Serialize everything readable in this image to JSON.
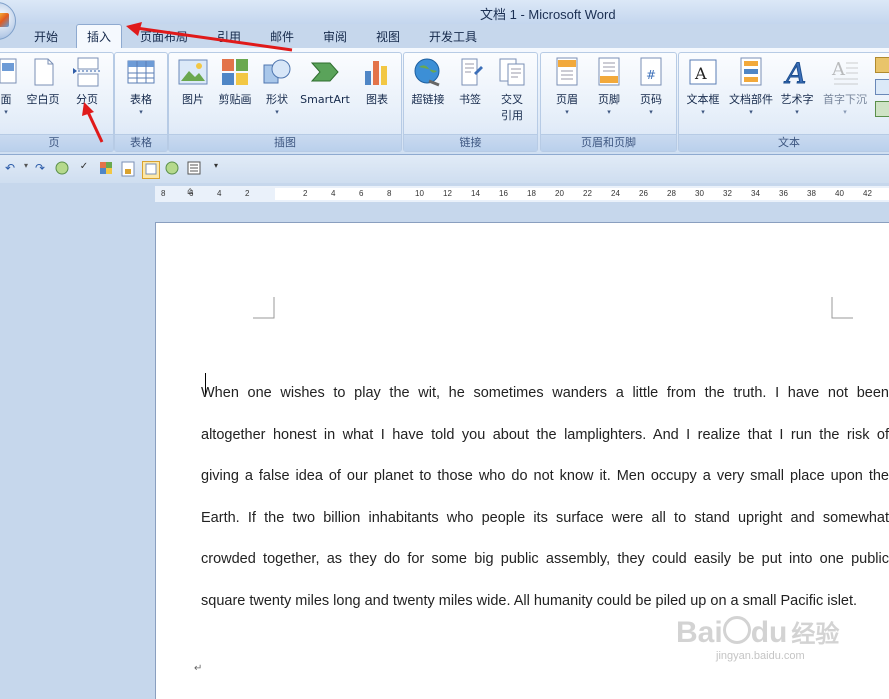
{
  "window": {
    "title": "文档 1 - Microsoft Word"
  },
  "tabs": [
    {
      "label": "开始"
    },
    {
      "label": "插入"
    },
    {
      "label": "页面布局"
    },
    {
      "label": "引用"
    },
    {
      "label": "邮件"
    },
    {
      "label": "审阅"
    },
    {
      "label": "视图"
    },
    {
      "label": "开发工具"
    }
  ],
  "groups": {
    "page": {
      "label": "页",
      "buttons": [
        "面",
        "空白页",
        "分页"
      ]
    },
    "table": {
      "label": "表格",
      "buttons": [
        "表格"
      ]
    },
    "illustrations": {
      "label": "插图",
      "buttons": [
        "图片",
        "剪贴画",
        "形状",
        "SmartArt",
        "图表"
      ]
    },
    "links": {
      "label": "链接",
      "buttons": [
        "超链接",
        "书签",
        "交叉\n引用"
      ]
    },
    "header_footer": {
      "label": "页眉和页脚",
      "buttons": [
        "页眉",
        "页脚",
        "页码"
      ]
    },
    "text": {
      "label": "文本",
      "buttons": [
        "文本框",
        "文档部件",
        "艺术字",
        "首字下沉"
      ]
    }
  },
  "ruler": {
    "numbers": [
      "8",
      "6",
      "4",
      "2",
      "2",
      "4",
      "6",
      "8",
      "10",
      "12",
      "14",
      "16",
      "18",
      "20",
      "22",
      "24",
      "26",
      "28",
      "30",
      "32",
      "34",
      "36",
      "38",
      "40",
      "42"
    ]
  },
  "document": {
    "lines": [
      "When one wishes to play the wit, he sometimes wanders a little from the truth. I have not been",
      "altogether honest in what I have told you about the lamplighters. And I realize that I run the risk of",
      "giving a false idea of our planet to those who do not know it. Men occupy a very small place upon the",
      "Earth. If the two billion inhabitants who people its surface were all to stand upright and somewhat",
      "crowded together, as they do for some big public assembly, they could easily be put into one public",
      "square twenty miles long and twenty miles wide. All humanity could be piled up on a small Pacific islet."
    ],
    "para_mark": "↵"
  },
  "watermark": {
    "brand": "Bai",
    "brand2": "du",
    "cn": "经验",
    "url": "jingyan.baidu.com"
  }
}
